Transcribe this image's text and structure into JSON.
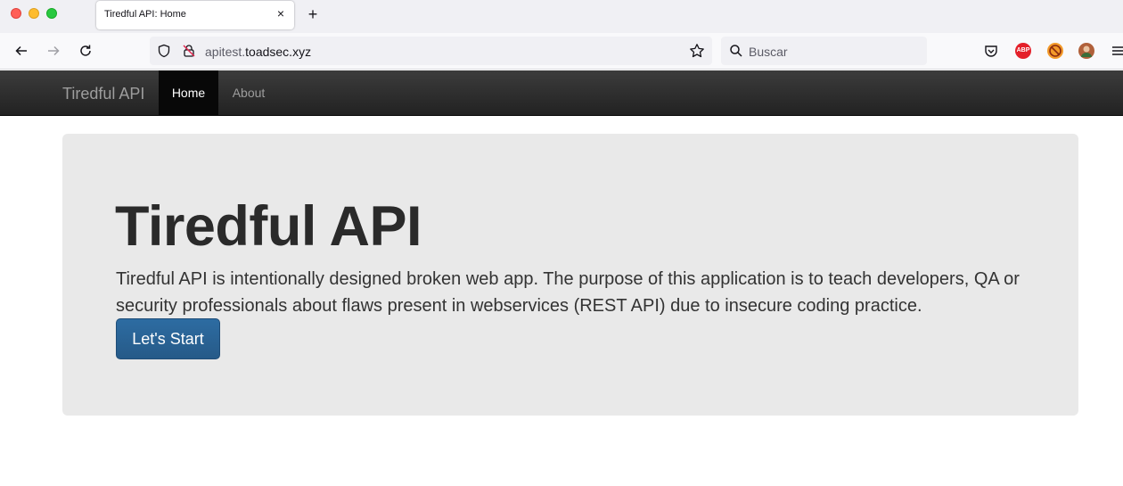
{
  "browser": {
    "tab_title": "Tiredful API: Home",
    "tab_close": "×",
    "new_tab": "+",
    "url_prefix": "apitest.",
    "url_host": "toadsec.xyz",
    "search_placeholder": "Buscar",
    "abp_label": "ABP",
    "icons": [
      "back-icon",
      "forward-icon",
      "reload-icon",
      "shield-icon",
      "lock-icon",
      "bookmark-star-icon",
      "search-icon",
      "pocket-icon",
      "adblock-icon",
      "extension-icon",
      "avatar-icon",
      "menu-icon"
    ]
  },
  "navbar": {
    "brand": "Tiredful API",
    "items": [
      {
        "label": "Home",
        "active": true
      },
      {
        "label": "About",
        "active": false
      }
    ]
  },
  "jumbotron": {
    "title": "Tiredful API",
    "text": "Tiredful API is intentionally designed broken web app. The purpose of this application is to teach developers, QA or security professionals about flaws present in webservices (REST API) due to insecure coding practice.",
    "button_label": "Let's Start"
  },
  "colors": {
    "navbar_bg": "#222222",
    "active_nav_bg": "#080808",
    "jumbotron_bg": "#e9e9e9",
    "button_bg": "#265a88"
  }
}
